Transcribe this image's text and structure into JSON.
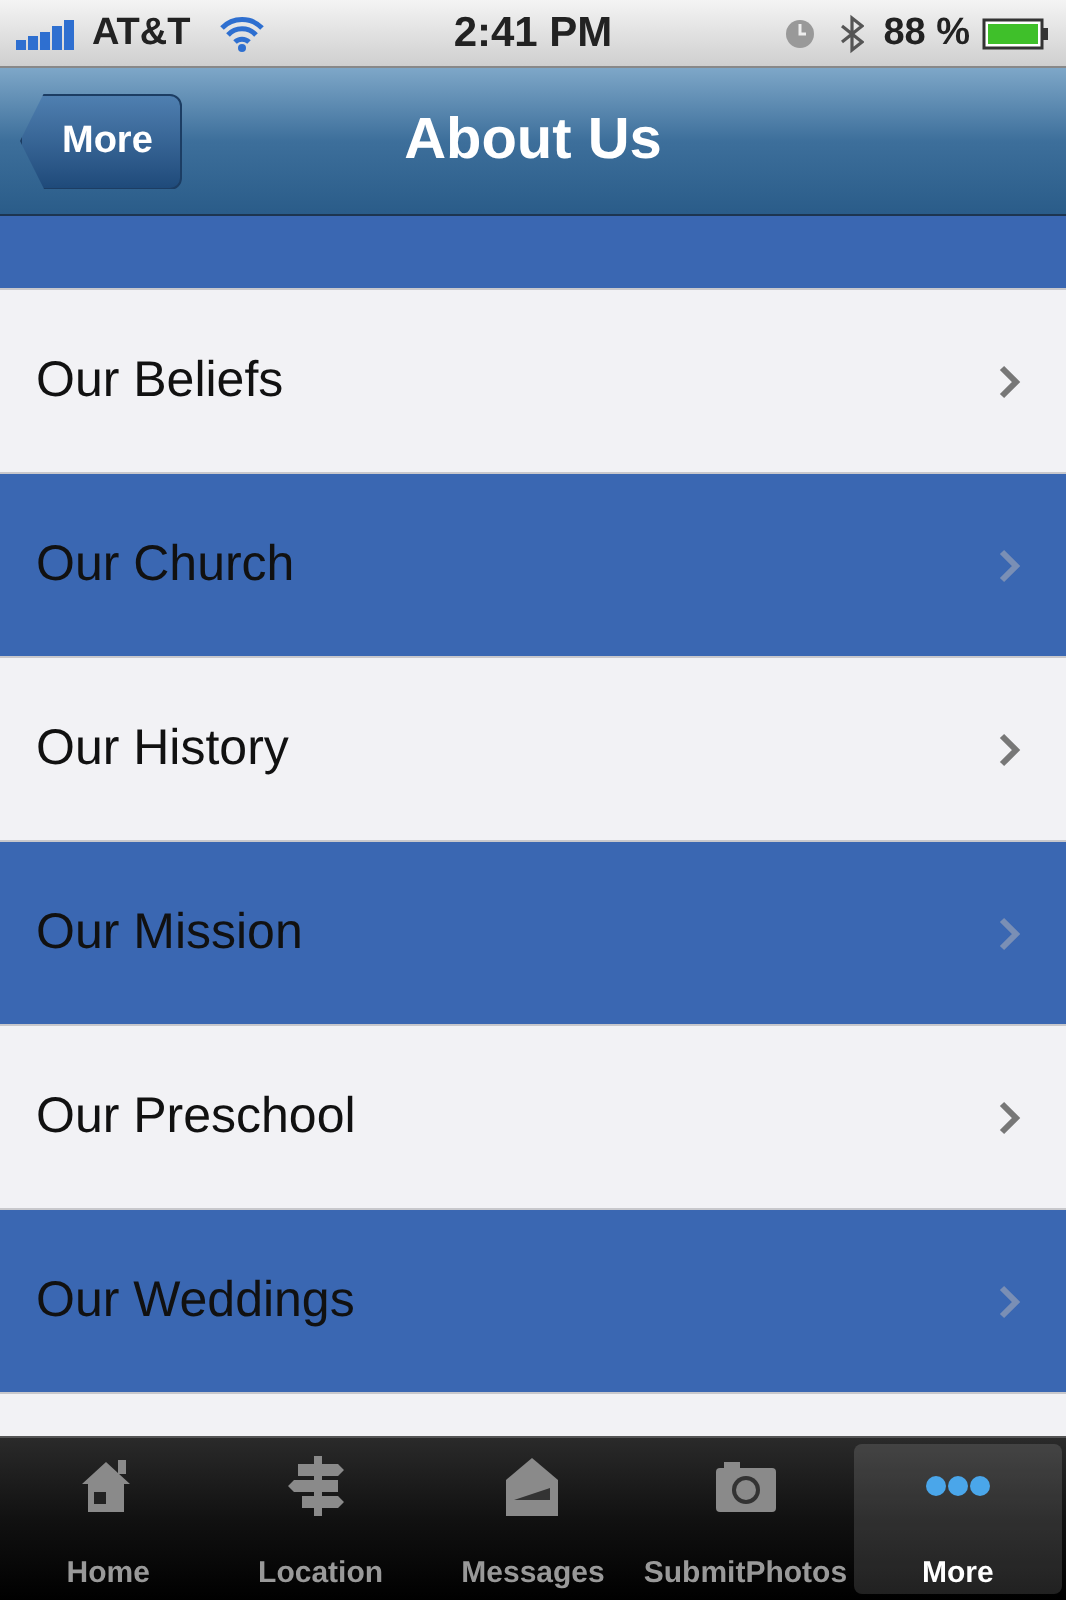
{
  "status_bar": {
    "carrier": "AT&T",
    "time": "2:41 PM",
    "battery": "88 %"
  },
  "nav_bar": {
    "back_button": "More",
    "title": "About Us"
  },
  "rows": [
    {
      "label": "Our Beliefs",
      "kind": "light"
    },
    {
      "label": "Our Church",
      "kind": "blue"
    },
    {
      "label": "Our History",
      "kind": "light"
    },
    {
      "label": "Our Mission",
      "kind": "blue"
    },
    {
      "label": "Our Preschool",
      "kind": "light"
    },
    {
      "label": "Our Weddings",
      "kind": "blue"
    }
  ],
  "tab_bar": [
    {
      "label": "Home",
      "kind": "home",
      "selected": false
    },
    {
      "label": "Location",
      "kind": "location",
      "selected": false
    },
    {
      "label": "Messages",
      "kind": "messages",
      "selected": false
    },
    {
      "label": "SubmitPhotos",
      "kind": "photos",
      "selected": false
    },
    {
      "label": "More",
      "kind": "more",
      "selected": true
    }
  ]
}
